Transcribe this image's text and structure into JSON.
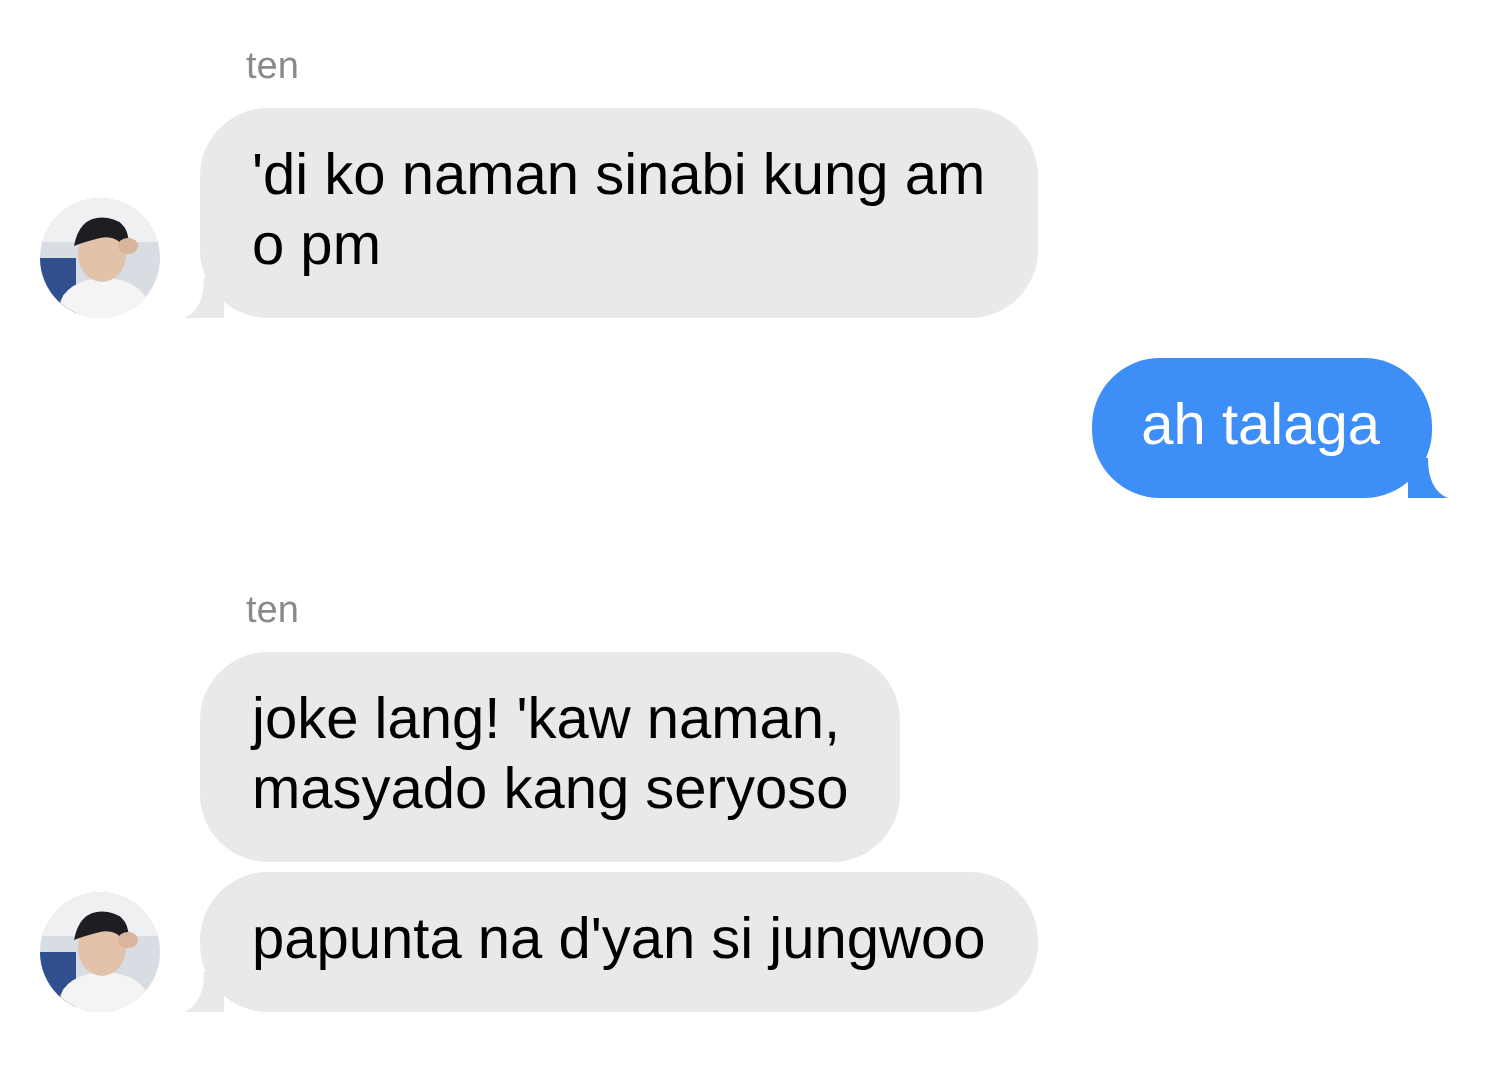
{
  "messages": [
    {
      "kind": "incoming",
      "sender": "ten",
      "lines": [
        "'di ko naman sinabi kung am",
        "o pm"
      ],
      "avatar": true,
      "tail": true
    },
    {
      "kind": "outgoing",
      "lines": [
        "ah talaga"
      ],
      "tail": true
    },
    {
      "kind": "incoming",
      "sender": "ten",
      "lines": [
        "joke lang! 'kaw naman,",
        "masyado kang seryoso"
      ],
      "avatar": false,
      "tail": false
    },
    {
      "kind": "incoming",
      "lines": [
        "papunta na d'yan si jungwoo"
      ],
      "avatar": true,
      "tail": true
    }
  ]
}
